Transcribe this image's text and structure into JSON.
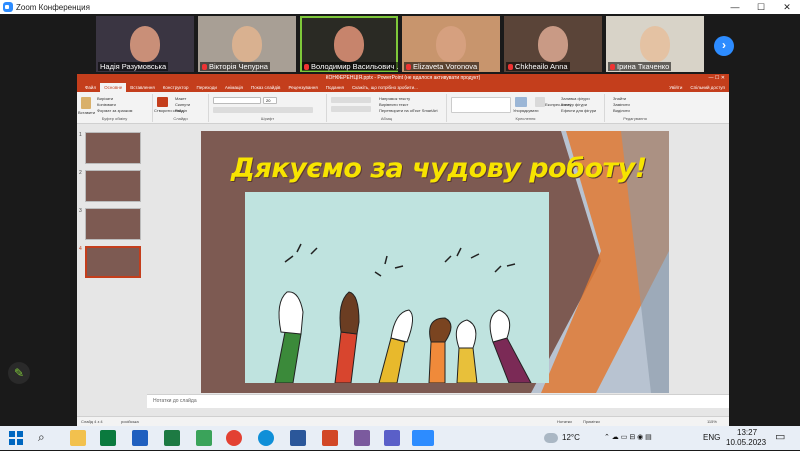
{
  "zoom": {
    "window_title": "Zoom Конференция",
    "controls": [
      "—",
      "☐",
      "✕"
    ]
  },
  "participants": [
    {
      "name": "Надія Разумовська",
      "muted": false,
      "bg": "#3a3542",
      "face": "#c98f78"
    },
    {
      "name": "Вікторія Чепурна",
      "muted": true,
      "bg": "#a89f95",
      "face": "#d9b190"
    },
    {
      "name": "Володимир Васильович ...",
      "muted": true,
      "bg": "#2a2a24",
      "face": "#c7846c",
      "active": true
    },
    {
      "name": "Elizaveta Voronova",
      "muted": true,
      "bg": "#c8956d",
      "face": "#d6a07f"
    },
    {
      "name": "Chkheailo Anna",
      "muted": true,
      "bg": "#5a4438",
      "face": "#c99a85"
    },
    {
      "name": "Ірина Ткаченко",
      "muted": true,
      "bg": "#d8d3c8",
      "face": "#e4c2a3"
    }
  ],
  "next_page_icon": "chevron-right",
  "ppt": {
    "title_bar": "КОНФЕРЕНЦІЯ.pptx - PowerPoint (не вдалося активувати продукт)",
    "user": "Увійти",
    "share": "Спільний доступ",
    "tabs": [
      "Файл",
      "Основне",
      "Вставлення",
      "Конструктор",
      "Переходи",
      "Анімація",
      "Показ слайдів",
      "Рецензування",
      "Подання",
      "Скажіть, що потрібно зробити..."
    ],
    "active_tab": "Основне",
    "ribbon": {
      "paste": "Вставити",
      "cut": "Вирізати",
      "copy": "Копіювати",
      "format_painter": "Формат за зразком",
      "clipboard_group": "Буфер обміну",
      "new_slide": "Створити слайд",
      "layout": "Макет",
      "reset": "Скинути",
      "section": "Розділ",
      "slides_group": "Слайди",
      "font_group": "Шрифт",
      "text_direction": "Напрямок тексту",
      "align_text": "Вирівняти текст",
      "smartart": "Перетворити на об'єкт SmartArt",
      "paragraph_group": "Абзац",
      "arrange": "Упорядкувати",
      "quick_styles": "Експрес-стилі",
      "shape_fill": "Заливка фігури",
      "shape_outline": "Контур фігури",
      "shape_effects": "Ефекти для фігури",
      "drawing_group": "Креслення",
      "find": "Знайти",
      "replace": "Замінити",
      "select": "Виділити",
      "editing_group": "Редагування",
      "font_size": "20"
    },
    "thumbs": [
      {
        "num": "1",
        "color": "#7d5a52"
      },
      {
        "num": "2",
        "color": "#7d5a52"
      },
      {
        "num": "3",
        "color": "#7d5a52"
      },
      {
        "num": "4",
        "color": "#7d5a52",
        "selected": true
      }
    ],
    "slide_title": "Дякуємо за чудову роботу!",
    "notes_placeholder": "Нотатки до слайда",
    "status": {
      "slide": "Слайд 4 з 4",
      "language": "російська",
      "notes": "Нотатки",
      "comments": "Примітки",
      "zoom": "115%"
    }
  },
  "taskbar": {
    "temperature": "12°C",
    "language": "ENG",
    "time": "13:27",
    "date": "10.05.2023"
  },
  "colors": {
    "ppt_accent": "#c43e1c",
    "zoom_blue": "#2d8cff",
    "slide_bg": "#7d5a52",
    "title_yellow": "#f7e400",
    "active_speaker": "#7ec83a"
  }
}
